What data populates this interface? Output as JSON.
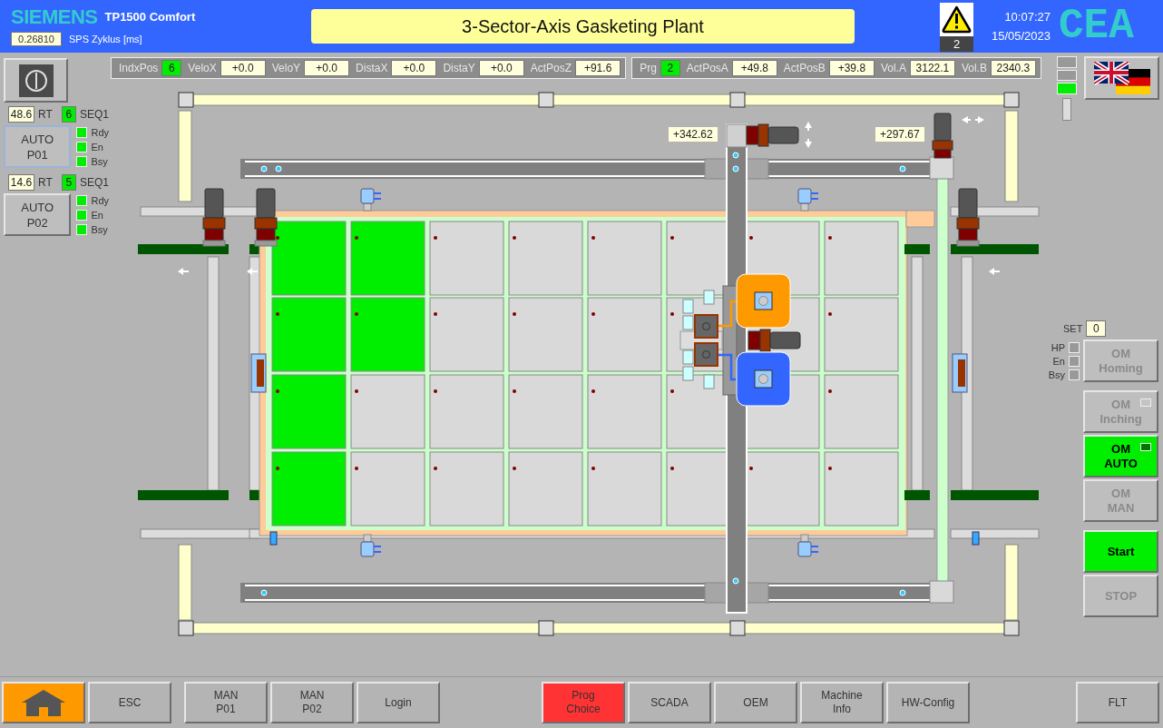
{
  "header": {
    "brand": "SIEMENS",
    "model": "TP1500 Comfort",
    "cycle_time": "0.26810",
    "cycle_label": "SPS Zyklus [ms]",
    "title": "3-Sector-Axis Gasketing Plant",
    "alarm_count": "2",
    "time": "10:07:27",
    "date": "15/05/2023",
    "logo": "CEA"
  },
  "stations": [
    {
      "runtime": "48.6",
      "runtime_label": "RT",
      "step": "6",
      "sequence": "SEQ1",
      "button": [
        "AUTO",
        "P01"
      ],
      "focused": true,
      "signals": [
        {
          "label": "Rdy",
          "on": true
        },
        {
          "label": "En",
          "on": true
        },
        {
          "label": "Bsy",
          "on": true
        }
      ]
    },
    {
      "runtime": "14.6",
      "runtime_label": "RT",
      "step": "5",
      "sequence": "SEQ1",
      "button": [
        "AUTO",
        "P02"
      ],
      "focused": false,
      "signals": [
        {
          "label": "Rdy",
          "on": true
        },
        {
          "label": "En",
          "on": true
        },
        {
          "label": "Bsy",
          "on": true
        }
      ]
    }
  ],
  "readouts": [
    {
      "items": [
        {
          "label": "IndxPos",
          "value": "6",
          "kind": "led"
        },
        {
          "label": "VeloX",
          "value": "+0.0",
          "kind": "field"
        },
        {
          "label": "VeloY",
          "value": "+0.0",
          "kind": "field"
        },
        {
          "label": "DistaX",
          "value": "+0.0",
          "kind": "field"
        },
        {
          "label": "DistaY",
          "value": "+0.0",
          "kind": "field"
        },
        {
          "label": "ActPosZ",
          "value": "+91.6",
          "kind": "field"
        }
      ]
    },
    {
      "items": [
        {
          "label": "Prg",
          "value": "2",
          "kind": "led"
        },
        {
          "label": "ActPosA",
          "value": "+49.8",
          "kind": "field"
        },
        {
          "label": "ActPosB",
          "value": "+39.8",
          "kind": "field"
        },
        {
          "label": "Vol.A",
          "value": "3122.1",
          "kind": "field"
        },
        {
          "label": "Vol.B",
          "value": "2340.3",
          "kind": "field"
        }
      ]
    }
  ],
  "status_leds": [
    {
      "on": false
    },
    {
      "on": false
    },
    {
      "on": true
    }
  ],
  "table": {
    "rows": [
      {
        "cells": [
          {
            "filled": true
          },
          {
            "filled": true
          },
          {
            "filled": false
          },
          {
            "filled": false
          },
          {
            "filled": false
          },
          {
            "filled": false
          },
          {
            "filled": false
          },
          {
            "filled": false
          }
        ]
      },
      {
        "cells": [
          {
            "filled": true
          },
          {
            "filled": true
          },
          {
            "filled": false
          },
          {
            "filled": false
          },
          {
            "filled": false
          },
          {
            "filled": false
          },
          {
            "filled": false
          },
          {
            "filled": false
          }
        ]
      },
      {
        "cells": [
          {
            "filled": true
          },
          {
            "filled": false
          },
          {
            "filled": false
          },
          {
            "filled": false
          },
          {
            "filled": false
          },
          {
            "filled": false
          },
          {
            "filled": false
          },
          {
            "filled": false
          }
        ]
      },
      {
        "cells": [
          {
            "filled": true
          },
          {
            "filled": false
          },
          {
            "filled": false
          },
          {
            "filled": false
          },
          {
            "filled": false
          },
          {
            "filled": false
          },
          {
            "filled": false
          },
          {
            "filled": false
          }
        ]
      }
    ]
  },
  "axis_readouts": [
    {
      "value": "+342.62"
    },
    {
      "value": "+297.67"
    }
  ],
  "mode_panel": {
    "set_label": "SET",
    "set_value": "0",
    "signals": [
      {
        "label": "HP",
        "on": false
      },
      {
        "label": "En",
        "on": false
      },
      {
        "label": "Bsy",
        "on": false
      }
    ],
    "buttons": [
      {
        "lines": [
          "OM",
          "Homing"
        ],
        "active": false
      },
      {
        "lines": [
          "OM",
          "Inching"
        ],
        "active": false,
        "indicator_on": false
      },
      {
        "lines": [
          "OM",
          "AUTO"
        ],
        "active": true,
        "indicator_on": true
      },
      {
        "lines": [
          "OM",
          "MAN"
        ],
        "active": false
      },
      {
        "lines": [
          "Start"
        ],
        "active": true
      },
      {
        "lines": [
          "STOP"
        ],
        "active": false
      }
    ]
  },
  "footer": {
    "groups": [
      [
        {
          "kind": "home",
          "color": "#ff9900"
        },
        {
          "kind": "text",
          "lines": [
            "ESC"
          ],
          "color": "#b4b4b4"
        }
      ],
      [
        {
          "kind": "text",
          "lines": [
            "MAN",
            "P01"
          ],
          "color": "#b4b4b4"
        },
        {
          "kind": "text",
          "lines": [
            "MAN",
            "P02"
          ],
          "color": "#b4b4b4"
        },
        {
          "kind": "text",
          "lines": [
            "Login"
          ],
          "color": "#b4b4b4"
        }
      ],
      [
        {
          "kind": "text",
          "lines": [
            "Prog",
            "Choice"
          ],
          "color": "#ff3333"
        },
        {
          "kind": "text",
          "lines": [
            "SCADA"
          ],
          "color": "#b4b4b4"
        },
        {
          "kind": "text",
          "lines": [
            "OEM"
          ],
          "color": "#b4b4b4"
        },
        {
          "kind": "text",
          "lines": [
            "Machine",
            "Info"
          ],
          "color": "#b4b4b4"
        },
        {
          "kind": "text",
          "lines": [
            "HW-Config"
          ],
          "color": "#b4b4b4"
        }
      ],
      [
        {
          "kind": "text",
          "lines": [
            "FLT"
          ],
          "color": "#b4b4b4"
        }
      ]
    ]
  }
}
